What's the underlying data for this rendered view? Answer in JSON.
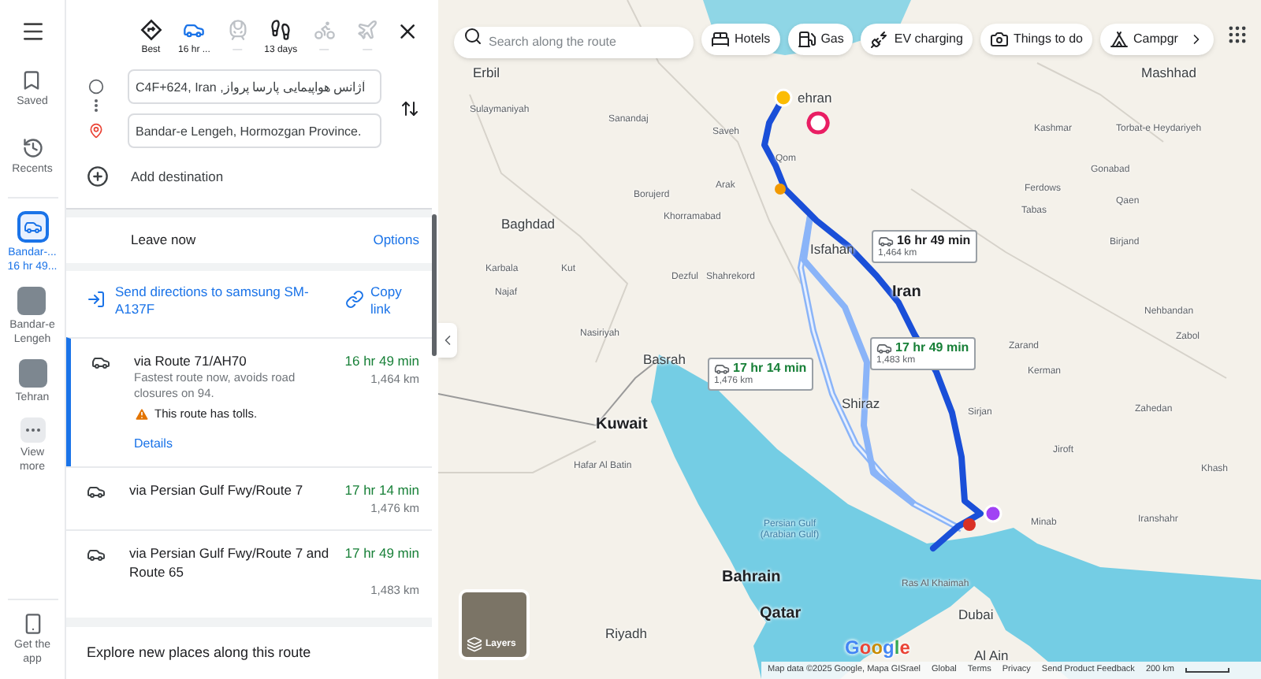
{
  "rail": {
    "top": [
      {
        "kind": "saved",
        "label": "Saved"
      },
      {
        "kind": "recents",
        "label": "Recents"
      }
    ],
    "recents": [
      {
        "kind": "directions",
        "lines": [
          "Bandar-...",
          "16 hr 49..."
        ],
        "selected": true
      },
      {
        "kind": "photo",
        "lines": [
          "Bandar-e",
          "Lengeh"
        ],
        "selected": false
      },
      {
        "kind": "photo",
        "lines": [
          "Tehran"
        ],
        "selected": false
      }
    ],
    "view_more": [
      "View",
      "more"
    ],
    "get_app": [
      "Get the",
      "app"
    ]
  },
  "modes": [
    {
      "kind": "best",
      "label": "Best",
      "selected": false,
      "disabled": false
    },
    {
      "kind": "car",
      "label": "16 hr ...",
      "selected": true,
      "disabled": false
    },
    {
      "kind": "transit",
      "label": "—",
      "selected": false,
      "disabled": true
    },
    {
      "kind": "walk",
      "label": "13 days",
      "selected": false,
      "disabled": false
    },
    {
      "kind": "bike",
      "label": "—",
      "selected": false,
      "disabled": true
    },
    {
      "kind": "flight",
      "label": "—",
      "selected": false,
      "disabled": true
    }
  ],
  "waypoints": [
    {
      "kind": "origin",
      "value": "C4F+624, Iran ,آژانس هواپیمایی پارسا پرواز"
    },
    {
      "kind": "destination",
      "value": "Bandar-e Lengeh, Hormozgan Province."
    }
  ],
  "add_destination": "Add destination",
  "leave": {
    "label": "Leave now",
    "options": "Options"
  },
  "share": {
    "send": "Send directions to samsung SM-A137F",
    "copy": "Copy link"
  },
  "routes": [
    {
      "title": "via Route 71/AH70",
      "duration": "16 hr 49 min",
      "distance": "1,464 km",
      "description": "Fastest route now, avoids road closures on 94.",
      "warning": "This route has tolls.",
      "link": "Details",
      "selected": true
    },
    {
      "title": "via Persian Gulf Fwy/Route 7",
      "duration": "17 hr 14 min",
      "distance": "1,476 km",
      "selected": false
    },
    {
      "title": "via Persian Gulf Fwy/Route 7 and Route 65",
      "duration": "17 hr 49 min",
      "distance": "1,483 km",
      "selected": false
    }
  ],
  "explore": "Explore new places along this route",
  "map": {
    "search": {
      "placeholder": "Search along the route"
    },
    "chips": [
      {
        "kind": "hotel",
        "label": "Hotels"
      },
      {
        "kind": "gas",
        "label": "Gas"
      },
      {
        "kind": "ev",
        "label": "EV charging"
      },
      {
        "kind": "camera",
        "label": "Things to do"
      },
      {
        "kind": "camping",
        "label": "Campgr"
      }
    ],
    "places": [
      {
        "label": "Erbil",
        "kind": "major"
      },
      {
        "label": "Mashhad",
        "kind": "major"
      },
      {
        "label": "ehran",
        "kind": "major"
      },
      {
        "label": "Sulaymaniyah",
        "kind": "minor"
      },
      {
        "label": "Sanandaj",
        "kind": "minor"
      },
      {
        "label": "Saveh",
        "kind": "minor"
      },
      {
        "label": "Qom",
        "kind": "minor"
      },
      {
        "label": "Arak",
        "kind": "minor"
      },
      {
        "label": "Borujerd",
        "kind": "minor"
      },
      {
        "label": "Khorramabad",
        "kind": "minor"
      },
      {
        "label": "Baghdad",
        "kind": "major"
      },
      {
        "label": "Kashmar",
        "kind": "minor"
      },
      {
        "label": "Torbat-e Heydariyeh",
        "kind": "minor"
      },
      {
        "label": "Gonabad",
        "kind": "minor"
      },
      {
        "label": "Ferdows",
        "kind": "minor"
      },
      {
        "label": "Tabas",
        "kind": "minor"
      },
      {
        "label": "Qaen",
        "kind": "minor"
      },
      {
        "label": "Birjand",
        "kind": "minor"
      },
      {
        "label": "Isfahan",
        "kind": "major"
      },
      {
        "label": "Karbala",
        "kind": "minor"
      },
      {
        "label": "Kut",
        "kind": "minor"
      },
      {
        "label": "Dezful",
        "kind": "minor"
      },
      {
        "label": "Shahrekord",
        "kind": "minor"
      },
      {
        "label": "Najaf",
        "kind": "minor"
      },
      {
        "label": "Iran",
        "kind": "country"
      },
      {
        "label": "Nehbandan",
        "kind": "minor"
      },
      {
        "label": "Nasiriyah",
        "kind": "minor"
      },
      {
        "label": "Zabol",
        "kind": "minor"
      },
      {
        "label": "Zarand",
        "kind": "minor"
      },
      {
        "label": "Basrah",
        "kind": "major"
      },
      {
        "label": "Kerman",
        "kind": "minor"
      },
      {
        "label": "Shiraz",
        "kind": "major"
      },
      {
        "label": "Sirjan",
        "kind": "minor"
      },
      {
        "label": "Zahedan",
        "kind": "minor"
      },
      {
        "label": "Kuwait",
        "kind": "country"
      },
      {
        "label": "Jiroft",
        "kind": "minor"
      },
      {
        "label": "Hafar Al Batin",
        "kind": "minor"
      },
      {
        "label": "Khash",
        "kind": "minor"
      },
      {
        "label": "Minab",
        "kind": "minor"
      },
      {
        "label": "Iranshahr",
        "kind": "minor"
      },
      {
        "label": "Persian Gulf (Arabian Gulf)",
        "kind": "water"
      },
      {
        "label": "Bahrain",
        "kind": "country"
      },
      {
        "label": "Ras Al Khaimah",
        "kind": "minor"
      },
      {
        "label": "Qatar",
        "kind": "country"
      },
      {
        "label": "Dubai",
        "kind": "major"
      },
      {
        "label": "Riyadh",
        "kind": "major"
      },
      {
        "label": "Al Ain",
        "kind": "major"
      }
    ],
    "route_labels": [
      {
        "duration": "16 hr 49 min",
        "distance": "1,464 km",
        "selected": true
      },
      {
        "duration": "17 hr 14 min",
        "distance": "1,476 km",
        "selected": false
      },
      {
        "duration": "17 hr 49 min",
        "distance": "1,483 km",
        "selected": false
      }
    ],
    "layers": "Layers",
    "logo": "Google",
    "footer": [
      "Map data ©2025 Google, Mapa GISrael",
      "Global",
      "Terms",
      "Privacy",
      "Send Product Feedback"
    ],
    "scale": "200 km"
  }
}
